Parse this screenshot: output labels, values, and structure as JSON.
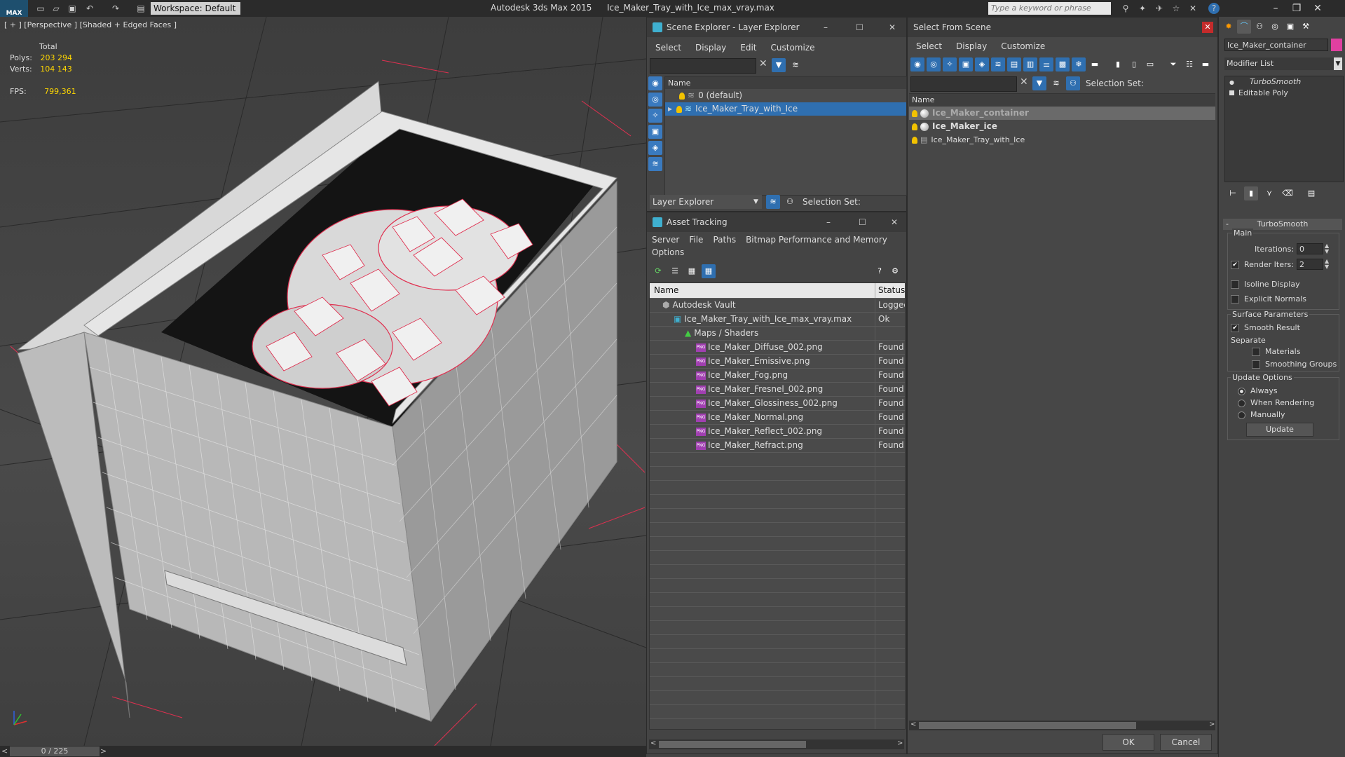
{
  "titlebar": {
    "logo": "MAX",
    "workspace": "Workspace: Default",
    "app_name": "Autodesk 3ds Max  2015",
    "file_name": "Ice_Maker_Tray_with_Ice_max_vray.max",
    "search_placeholder": "Type a keyword or phrase"
  },
  "viewport": {
    "label": "[ + ] [Perspective ] [Shaded + Edged Faces ]",
    "stats": {
      "total_label": "Total",
      "polys_label": "Polys:",
      "polys_value": "203 294",
      "verts_label": "Verts:",
      "verts_value": "104 143",
      "fps_label": "FPS:",
      "fps_value": "799,361"
    },
    "time_slider": "0 / 225"
  },
  "scene_explorer": {
    "title": "Scene Explorer - Layer Explorer",
    "menu": [
      "Select",
      "Display",
      "Edit",
      "Customize"
    ],
    "column_name": "Name",
    "layers": [
      {
        "name": "0 (default)",
        "selected": false
      },
      {
        "name": "Ice_Maker_Tray_with_Ice",
        "selected": true
      }
    ],
    "footer_dropdown": "Layer Explorer",
    "selection_set_label": "Selection Set:"
  },
  "asset_tracking": {
    "title": "Asset Tracking",
    "menu": [
      "Server",
      "File",
      "Paths",
      "Bitmap Performance and Memory"
    ],
    "menu_row2": "Options",
    "col_name": "Name",
    "col_status": "Status",
    "rows": [
      {
        "name": "Autodesk Vault",
        "status": "Logged",
        "indent": 0,
        "kind": "vault"
      },
      {
        "name": "Ice_Maker_Tray_with_Ice_max_vray.max",
        "status": "Ok",
        "indent": 1,
        "kind": "max"
      },
      {
        "name": "Maps / Shaders",
        "status": "",
        "indent": 2,
        "kind": "maps"
      },
      {
        "name": "Ice_Maker_Diffuse_002.png",
        "status": "Found",
        "indent": 3,
        "kind": "png"
      },
      {
        "name": "Ice_Maker_Emissive.png",
        "status": "Found",
        "indent": 3,
        "kind": "png"
      },
      {
        "name": "Ice_Maker_Fog.png",
        "status": "Found",
        "indent": 3,
        "kind": "png"
      },
      {
        "name": "Ice_Maker_Fresnel_002.png",
        "status": "Found",
        "indent": 3,
        "kind": "png"
      },
      {
        "name": "Ice_Maker_Glossiness_002.png",
        "status": "Found",
        "indent": 3,
        "kind": "png"
      },
      {
        "name": "Ice_Maker_Normal.png",
        "status": "Found",
        "indent": 3,
        "kind": "png"
      },
      {
        "name": "Ice_Maker_Reflect_002.png",
        "status": "Found",
        "indent": 3,
        "kind": "png"
      },
      {
        "name": "Ice_Maker_Refract.png",
        "status": "Found",
        "indent": 3,
        "kind": "png"
      }
    ]
  },
  "select_from_scene": {
    "title": "Select From Scene",
    "menu": [
      "Select",
      "Display",
      "Customize"
    ],
    "selection_set_label": "Selection Set:",
    "column_name": "Name",
    "objects": [
      {
        "name": "Ice_Maker_container",
        "bold": true,
        "selected": true
      },
      {
        "name": "Ice_Maker_ice",
        "bold": true,
        "selected": false
      },
      {
        "name": "Ice_Maker_Tray_with_Ice",
        "bold": false,
        "selected": false
      }
    ],
    "ok_label": "OK",
    "cancel_label": "Cancel"
  },
  "command_panel": {
    "object_name": "Ice_Maker_container",
    "object_color": "#e040a0",
    "modifier_list": "Modifier List",
    "stack": [
      "TurboSmooth",
      "Editable Poly"
    ],
    "rollout_title": "TurboSmooth",
    "main_group": "Main",
    "iterations_label": "Iterations:",
    "iterations_value": "0",
    "render_iters_label": "Render Iters:",
    "render_iters_value": "2",
    "isoline_label": "Isoline Display",
    "explicit_normals_label": "Explicit Normals",
    "surface_group": "Surface Parameters",
    "smooth_result_label": "Smooth Result",
    "separate_label": "Separate",
    "materials_label": "Materials",
    "smoothing_groups_label": "Smoothing Groups",
    "update_group": "Update Options",
    "always_label": "Always",
    "when_rendering_label": "When Rendering",
    "manually_label": "Manually",
    "update_button": "Update"
  },
  "colors": {
    "selection_blue": "#2f6fb0",
    "stat_yellow": "#ffd700",
    "wire_red": "#e03050"
  }
}
